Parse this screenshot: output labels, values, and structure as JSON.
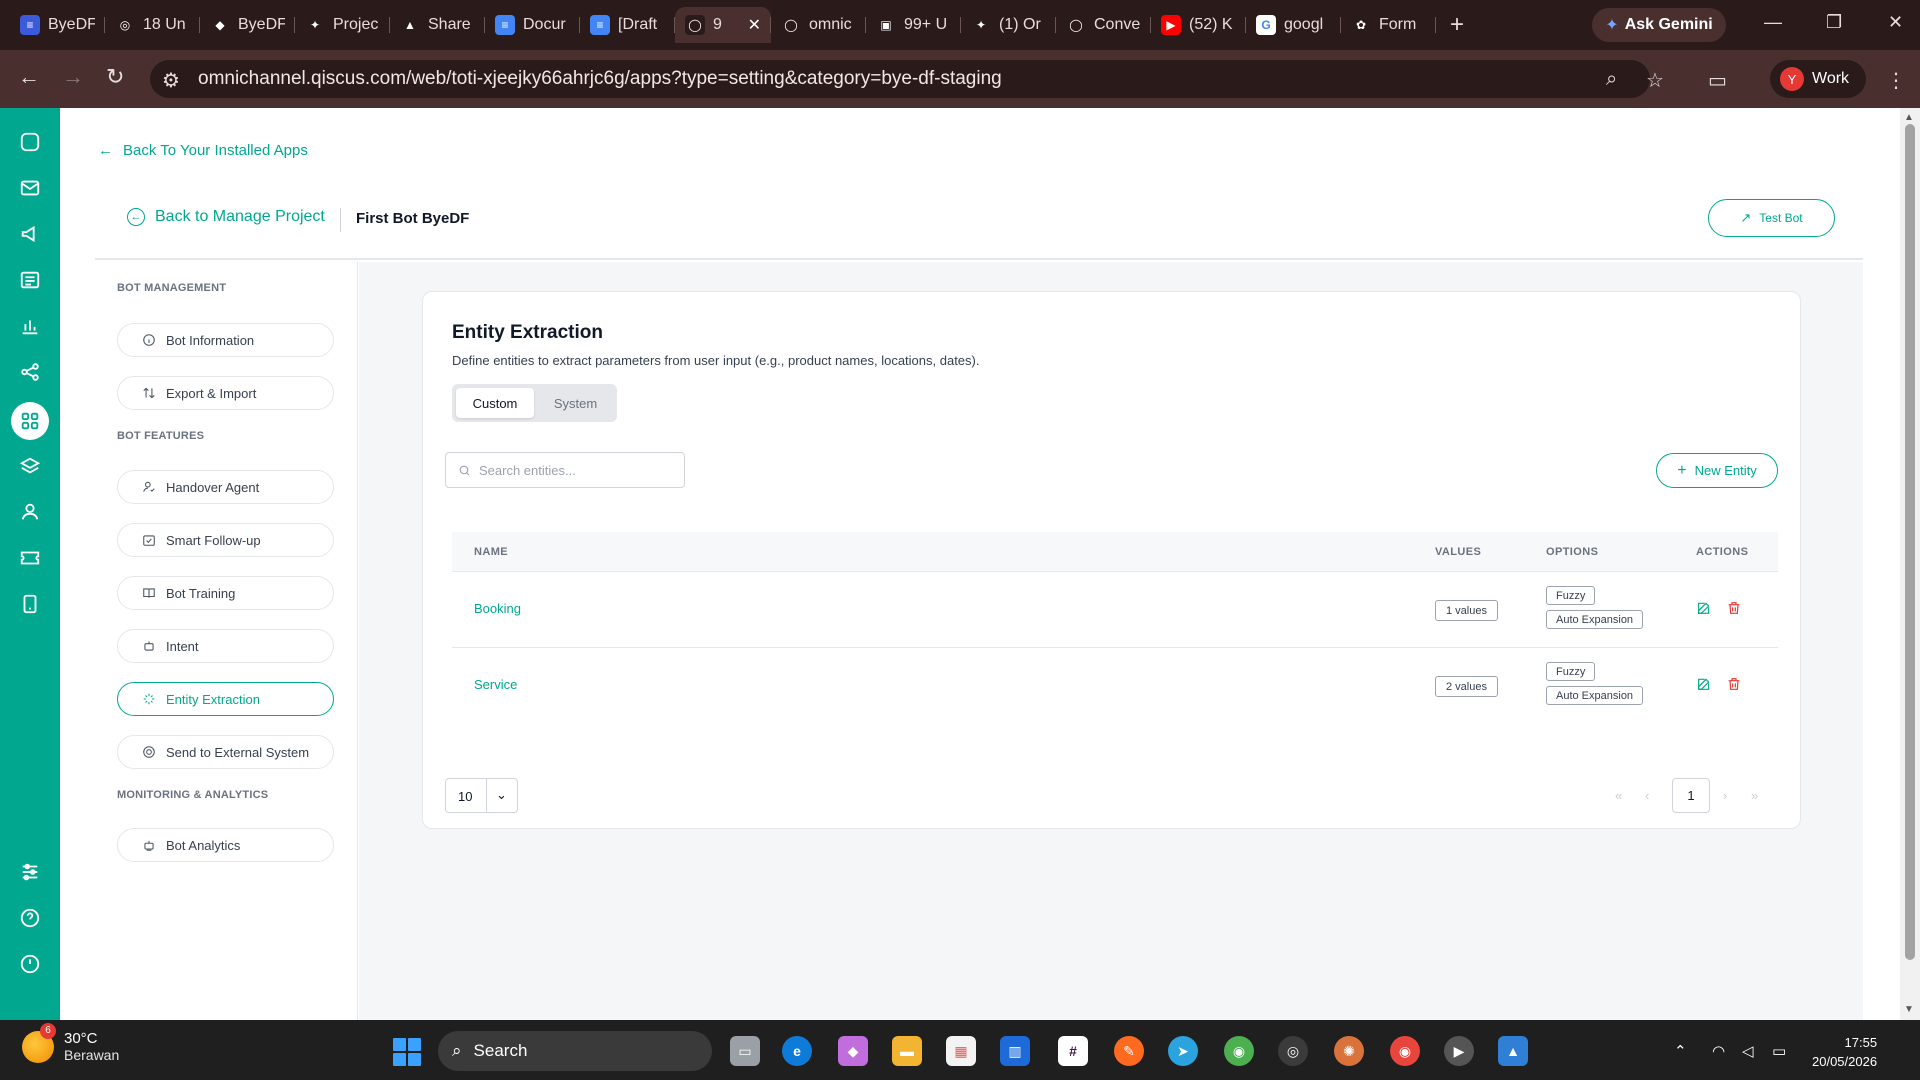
{
  "browser": {
    "tabs": [
      {
        "label": "ByeDF",
        "color": "#3b5bdb",
        "glyph": "≡"
      },
      {
        "label": "18 Un",
        "color": "#2b1a1a",
        "glyph": "◎"
      },
      {
        "label": "ByeDF",
        "color": "#2b1a1a",
        "glyph": "◆"
      },
      {
        "label": "Projec",
        "color": "#2b1a1a",
        "glyph": "✦"
      },
      {
        "label": "Share",
        "color": "#2b1a1a",
        "glyph": "▲"
      },
      {
        "label": "Docur",
        "color": "#4285f4",
        "glyph": "≡"
      },
      {
        "label": "[Draft",
        "color": "#4285f4",
        "glyph": "≡"
      },
      {
        "label": "9",
        "color": "#2b1a1a",
        "glyph": "◯",
        "active": true
      },
      {
        "label": "omnic",
        "color": "#2b1a1a",
        "glyph": "◯"
      },
      {
        "label": "99+ U",
        "color": "#2b1a1a",
        "glyph": "▣"
      },
      {
        "label": "(1) Or",
        "color": "#2b1a1a",
        "glyph": "✦"
      },
      {
        "label": "Conve",
        "color": "#2b1a1a",
        "glyph": "◯"
      },
      {
        "label": "(52) K",
        "color": "#ff0000",
        "glyph": "▶"
      },
      {
        "label": "googl",
        "color": "#ffffff",
        "glyph": "G"
      },
      {
        "label": "Form",
        "color": "#2b1a1a",
        "glyph": "✿"
      }
    ],
    "gemini_label": "Ask Gemini",
    "url": "omnichannel.qiscus.com/web/toti-xjeejky66ahrjc6g/apps?type=setting&category=bye-df-staging",
    "profile_initial": "Y",
    "profile_label": "Work"
  },
  "page": {
    "back_to_apps": "Back To Your Installed Apps",
    "back_to_manage": "Back to Manage Project",
    "bot_name": "First Bot ByeDF",
    "test_bot": "Test Bot"
  },
  "sidebar": {
    "section_management": "BOT MANAGEMENT",
    "section_features": "BOT FEATURES",
    "section_monitoring": "MONITORING & ANALYTICS",
    "bot_information": "Bot Information",
    "export_import": "Export & Import",
    "handover_agent": "Handover Agent",
    "smart_followup": "Smart Follow-up",
    "bot_training": "Bot Training",
    "intent": "Intent",
    "entity_extraction": "Entity Extraction",
    "send_external": "Send to External System",
    "bot_analytics": "Bot Analytics"
  },
  "entity": {
    "title": "Entity Extraction",
    "description": "Define entities to extract parameters from user input (e.g., product names, locations, dates).",
    "tab_custom": "Custom",
    "tab_system": "System",
    "search_placeholder": "Search entities...",
    "new_entity": "New Entity",
    "columns": {
      "name": "NAME",
      "values": "VALUES",
      "options": "OPTIONS",
      "actions": "ACTIONS"
    },
    "rows": [
      {
        "name": "Booking",
        "values": "1 values",
        "option1": "Fuzzy",
        "option2": "Auto Expansion"
      },
      {
        "name": "Service",
        "values": "2 values",
        "option1": "Fuzzy",
        "option2": "Auto Expansion"
      }
    ],
    "page_size": "10",
    "current_page": "1"
  },
  "taskbar": {
    "temperature": "30°C",
    "condition": "Berawan",
    "weather_badge": "6",
    "search_label": "Search",
    "time": "17:55",
    "date": "20/05/2026"
  }
}
